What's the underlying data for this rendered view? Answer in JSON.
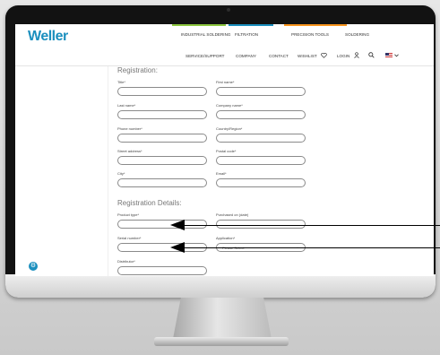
{
  "site": {
    "logo": "Weller"
  },
  "top_nav": [
    "INDUSTRIAL SOLDERING",
    "FILTRATION",
    "PRECISION TOOLS",
    "SOLDERING"
  ],
  "secondary_nav": [
    "SERVICE/SUPPORT",
    "COMPANY",
    "CONTACT",
    "WISHLIST",
    "LOGIN"
  ],
  "colors": {
    "brand": "#1b8fbe",
    "accent_green": "#8cc63f",
    "accent_blue": "#1b8fbe",
    "accent_orange": "#f7941d"
  },
  "registration": {
    "heading": "Registration:",
    "fields": {
      "title": "Title*",
      "first_name": "First name*",
      "last_name": "Last name*",
      "company_name": "Company name*",
      "phone": "Phone number*",
      "country": "Country/Region*",
      "street": "Street address*",
      "postal": "Postal code*",
      "city": "City*",
      "email": "Email*"
    }
  },
  "details": {
    "heading": "Registration Details:",
    "fields": {
      "product_type": "Product type*",
      "purchased_on": "Purchased on (date)",
      "serial_number": "Serial number*",
      "application": "Application*",
      "application_value": "Please Select",
      "distributor": "Distributor*"
    }
  },
  "icons": [
    "heart-icon",
    "user-icon",
    "search-icon",
    "us-flag-icon",
    "chevron-down-icon",
    "gear-icon"
  ]
}
